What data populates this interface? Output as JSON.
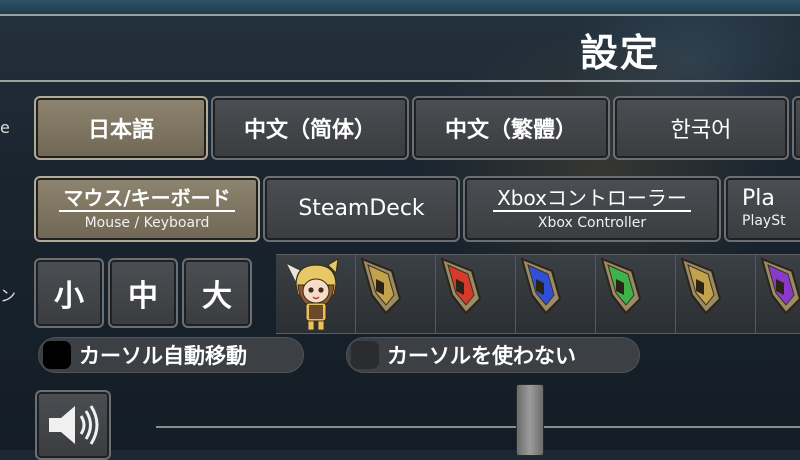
{
  "title": "設定",
  "left_labels": [
    "e",
    "ン"
  ],
  "languages": [
    {
      "label": "日本語",
      "selected": true
    },
    {
      "label": "中文（简体）",
      "selected": false
    },
    {
      "label": "中文（繁體）",
      "selected": false
    },
    {
      "label": "한국어",
      "selected": false
    }
  ],
  "controllers": [
    {
      "label": "マウス/キーボード",
      "sub": "Mouse / Keyboard",
      "selected": true
    },
    {
      "label": "SteamDeck",
      "sub": "",
      "selected": false
    },
    {
      "label": "Xboxコントローラー",
      "sub": "Xbox Controller",
      "selected": false
    },
    {
      "label": "Pla",
      "sub": "PlaySt",
      "selected": false
    }
  ],
  "cursor_sizes": [
    "小",
    "中",
    "大"
  ],
  "cursor_styles": [
    {
      "icon": "character-avatar-icon",
      "color": "#e8c060"
    },
    {
      "icon": "gold-cursor-icon",
      "color": "#c2a24a"
    },
    {
      "icon": "red-cursor-icon",
      "color": "#d63a2a"
    },
    {
      "icon": "blue-cursor-icon",
      "color": "#2f4fd8"
    },
    {
      "icon": "green-cursor-icon",
      "color": "#3fb34a"
    },
    {
      "icon": "gold-cursor-icon",
      "color": "#c2a24a"
    },
    {
      "icon": "purple-cursor-icon",
      "color": "#8a3ac8"
    }
  ],
  "options": {
    "auto_move_label": "カーソル自動移動",
    "no_cursor_label": "カーソルを使わない"
  },
  "volume": {
    "icon": "speaker-icon",
    "level_percent": 59
  }
}
